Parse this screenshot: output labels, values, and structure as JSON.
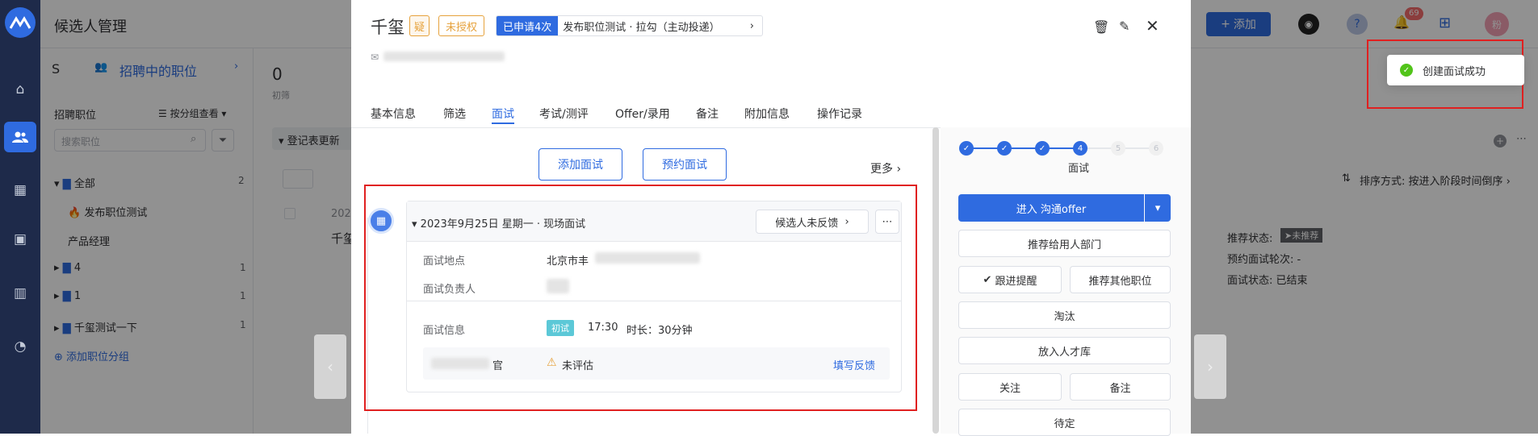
{
  "header": {
    "title": "候选人管理",
    "add_label": "添加",
    "notification_count": "69",
    "avatar_text": "粉"
  },
  "sidebar": {
    "scope_label": "招聘中的职位",
    "section_label": "招聘职位",
    "group_label": "按分组查看",
    "search_placeholder": "搜索职位",
    "tree": [
      {
        "label": "全部",
        "count": "2"
      },
      {
        "label": "发布职位测试"
      },
      {
        "label": "产品经理"
      },
      {
        "label": "4",
        "count": "1"
      },
      {
        "label": "1",
        "count": "1"
      },
      {
        "label": "千玺测试一下",
        "count": "1"
      }
    ],
    "add_group_label": "添加职位分组"
  },
  "list": {
    "stat_value": "0",
    "stat_label": "初筛",
    "filter_label": "登记表更新",
    "row_date": "202",
    "row_name": "千玺"
  },
  "right_bg": {
    "sort_label": "排序方式: 按进入阶段时间倒序",
    "recommend_status_label": "推荐状态:",
    "recommend_status_value": "未推荐",
    "interview_rounds": "预约面试轮次: -",
    "interview_status": "面试状态: 已结束"
  },
  "candidate": {
    "name": "千玺",
    "tag_doubt": "疑",
    "tag_unauth": "未授权",
    "applied": "已申请4次",
    "job_info": "发布职位测试 · 拉勾（主动投递）"
  },
  "tabs": [
    "基本信息",
    "筛选",
    "面试",
    "考试/测评",
    "Offer/录用",
    "备注",
    "附加信息",
    "操作记录"
  ],
  "actions": {
    "add_interview": "添加面试",
    "schedule_interview": "预约面试",
    "more": "更多"
  },
  "interview": {
    "title": "2023年9月25日 星期一 · 现场面试",
    "feedback_status": "候选人未反馈",
    "location_label": "面试地点",
    "location_value": "北京市丰",
    "owner_label": "面试负责人",
    "info_label": "面试信息",
    "round_badge": "初试",
    "time": "17:30",
    "duration": "时长：30分钟",
    "interviewer_suffix": "官",
    "eval_status": "未评估",
    "fill_feedback": "填写反馈"
  },
  "stage": {
    "steps": [
      "✓",
      "✓",
      "✓",
      "4",
      "5",
      "6"
    ],
    "current_label": "面试",
    "enter_button": "进入 沟通offer",
    "recommend_dept": "推荐给用人部门",
    "follow_up": "跟进提醒",
    "recommend_other": "推荐其他职位",
    "eliminate": "淘汰",
    "talent_pool": "放入人才库",
    "follow": "关注",
    "note": "备注",
    "pending": "待定"
  },
  "toast": {
    "message": "创建面试成功"
  },
  "colors": {
    "primary": "#2f6be0",
    "highlight": "#e02020",
    "success": "#52c41a",
    "warning": "#e6a23c",
    "rail": "#1e2a4a"
  }
}
